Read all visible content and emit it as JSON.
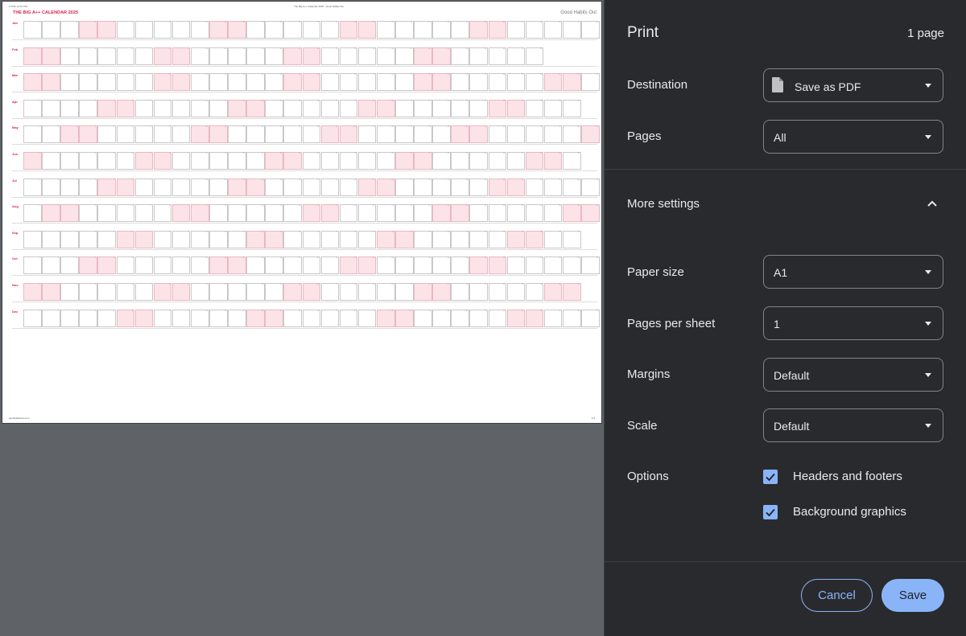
{
  "preview": {
    "header_left": "1/7/25, 10:37 PM",
    "header_center": "The Big A++ Calendar 2025 - Good Habits Out",
    "title": "THE BIG A++ CALENDAR 2025",
    "brand": "Good Habits Out",
    "footer_left": "goodhabitsout.com",
    "footer_right": "1/1",
    "months": [
      "Jan",
      "Feb",
      "Mar",
      "Apr",
      "May",
      "Jun",
      "Jul",
      "Aug",
      "Sep",
      "Oct",
      "Nov",
      "Dec"
    ],
    "accent_color": "#d6204c",
    "weekend_color": "#fbe3e8"
  },
  "panel": {
    "title": "Print",
    "page_count": "1 page",
    "destination": {
      "label": "Destination",
      "value": "Save as PDF",
      "icon": "file-icon"
    },
    "pages": {
      "label": "Pages",
      "value": "All"
    },
    "more_settings": {
      "label": "More settings",
      "icon": "chevron-up-icon"
    },
    "paper_size": {
      "label": "Paper size",
      "value": "A1"
    },
    "pages_per_sheet": {
      "label": "Pages per sheet",
      "value": "1"
    },
    "margins": {
      "label": "Margins",
      "value": "Default"
    },
    "scale": {
      "label": "Scale",
      "value": "Default"
    },
    "options": {
      "label": "Options",
      "headers_footers": {
        "label": "Headers and footers",
        "checked": true
      },
      "background_graphics": {
        "label": "Background graphics",
        "checked": true
      }
    },
    "buttons": {
      "cancel": "Cancel",
      "save": "Save"
    },
    "colors": {
      "background": "#292a2d",
      "accent": "#8ab4f8",
      "text": "#e8eaed"
    }
  }
}
